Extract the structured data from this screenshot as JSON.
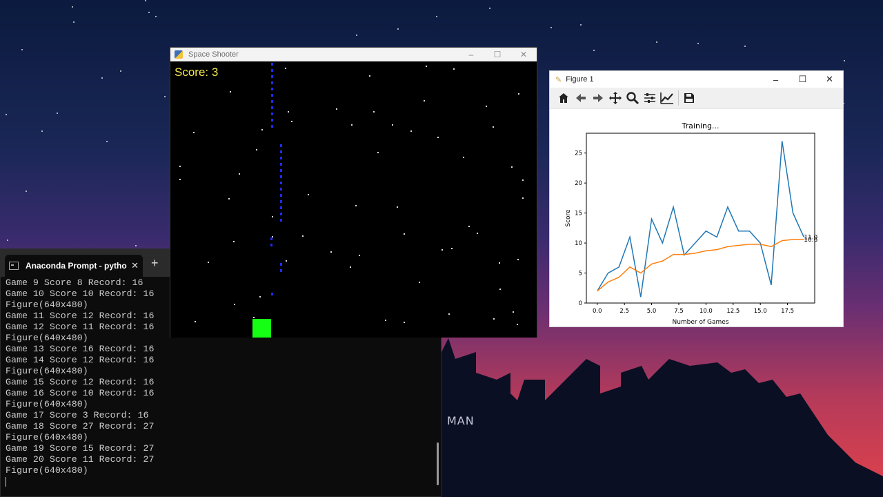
{
  "wallpaper": {
    "text": "MAN"
  },
  "terminal": {
    "tab_title": "Anaconda Prompt - python s",
    "close_glyph": "✕",
    "newtab_glyph": "+",
    "lines": [
      "Game 9 Score 8 Record: 16",
      "Game 10 Score 10 Record: 16",
      "Figure(640x480)",
      "Game 11 Score 12 Record: 16",
      "Game 12 Score 11 Record: 16",
      "Figure(640x480)",
      "Game 13 Score 16 Record: 16",
      "Game 14 Score 12 Record: 16",
      "Figure(640x480)",
      "Game 15 Score 12 Record: 16",
      "Game 16 Score 10 Record: 16",
      "Figure(640x480)",
      "Game 17 Score 3 Record: 16",
      "Game 18 Score 27 Record: 27",
      "Figure(640x480)",
      "Game 19 Score 15 Record: 27",
      "Game 20 Score 11 Record: 27",
      "Figure(640x480)"
    ]
  },
  "game_window": {
    "title": "Space Shooter",
    "score_text": "Score: 3",
    "minimize": "–",
    "maximize": "☐",
    "close": "✕"
  },
  "figure_window": {
    "title": "Figure 1",
    "minimize": "–",
    "maximize": "☐",
    "close": "✕",
    "toolbar": [
      "home-icon",
      "back-arrow-icon",
      "forward-arrow-icon",
      "pan-icon",
      "zoom-icon",
      "configure-subplots-icon",
      "edit-axis-icon",
      "save-icon"
    ]
  },
  "chart_data": {
    "type": "line",
    "title": "Training...",
    "xlabel": "Number of Games",
    "ylabel": "Score",
    "xlim": [
      -1,
      20
    ],
    "ylim": [
      0,
      28.3
    ],
    "xticks": [
      "0.0",
      "2.5",
      "5.0",
      "7.5",
      "10.0",
      "12.5",
      "15.0",
      "17.5"
    ],
    "xtick_values": [
      0,
      2.5,
      5,
      7.5,
      10,
      12.5,
      15,
      17.5
    ],
    "yticks": [
      "0",
      "5",
      "10",
      "15",
      "20",
      "25"
    ],
    "ytick_values": [
      0,
      5,
      10,
      15,
      20,
      25
    ],
    "series": [
      {
        "color": "#1f77b4",
        "x": [
          0,
          1,
          2,
          3,
          4,
          5,
          6,
          7,
          8,
          9,
          10,
          11,
          12,
          13,
          14,
          15,
          16,
          17,
          18,
          19
        ],
        "values": [
          2,
          5,
          6,
          11,
          1,
          14,
          10,
          16,
          8,
          10,
          12,
          11,
          16,
          12,
          12,
          10,
          3,
          27,
          15,
          11
        ]
      },
      {
        "color": "#ff7f0e",
        "x": [
          0,
          1,
          2,
          3,
          4,
          5,
          6,
          7,
          8,
          9,
          10,
          11,
          12,
          13,
          14,
          15,
          16,
          17,
          18,
          19
        ],
        "values": [
          2,
          3.5,
          4.3,
          6,
          5,
          6.5,
          7,
          8.1,
          8.1,
          8.3,
          8.7,
          8.9,
          9.4,
          9.6,
          9.8,
          9.8,
          9.4,
          10.4,
          10.6,
          10.6
        ]
      }
    ],
    "end_labels": [
      "11.0",
      "10.6"
    ]
  }
}
